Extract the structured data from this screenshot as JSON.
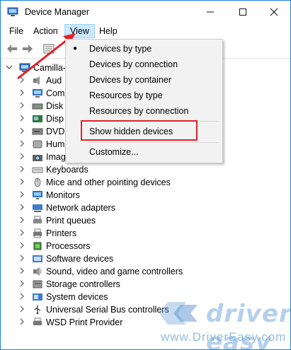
{
  "window": {
    "title": "Device Manager",
    "controls": {
      "minimize": "—",
      "maximize": "☐",
      "close": "✕"
    }
  },
  "menubar": {
    "file": "File",
    "action": "Action",
    "view": "View",
    "help": "Help"
  },
  "tree": {
    "root": "Camilla-",
    "items": [
      {
        "label": "Aud",
        "icon": "audio-icon"
      },
      {
        "label": "Com",
        "icon": "computer-icon"
      },
      {
        "label": "Disk",
        "icon": "disk-drive-icon"
      },
      {
        "label": "Disp",
        "icon": "display-adapter-icon"
      },
      {
        "label": "DVD",
        "icon": "dvd-drive-icon"
      },
      {
        "label": "Hum",
        "icon": "hid-icon"
      },
      {
        "label": "Imag",
        "icon": "imaging-icon"
      },
      {
        "label": "Keyboards",
        "icon": "keyboard-icon"
      },
      {
        "label": "Mice and other pointing devices",
        "icon": "mouse-icon"
      },
      {
        "label": "Monitors",
        "icon": "monitor-icon"
      },
      {
        "label": "Network adapters",
        "icon": "network-icon"
      },
      {
        "label": "Print queues",
        "icon": "print-queue-icon"
      },
      {
        "label": "Printers",
        "icon": "printer-icon"
      },
      {
        "label": "Processors",
        "icon": "processor-icon"
      },
      {
        "label": "Software devices",
        "icon": "software-device-icon"
      },
      {
        "label": "Sound, video and game controllers",
        "icon": "sound-icon"
      },
      {
        "label": "Storage controllers",
        "icon": "storage-icon"
      },
      {
        "label": "System devices",
        "icon": "system-device-icon"
      },
      {
        "label": "Universal Serial Bus controllers",
        "icon": "usb-icon"
      },
      {
        "label": "WSD Print Provider",
        "icon": "wsd-icon"
      }
    ]
  },
  "view_menu": {
    "items": [
      {
        "label": "Devices by type",
        "checked": true
      },
      {
        "label": "Devices by connection",
        "checked": false
      },
      {
        "label": "Devices by container",
        "checked": false
      },
      {
        "label": "Resources by type",
        "checked": false
      },
      {
        "label": "Resources by connection",
        "checked": false
      },
      {
        "label": "Show hidden devices",
        "checked": false,
        "highlighted": true
      },
      {
        "label": "Customize...",
        "checked": false
      }
    ]
  },
  "watermark": {
    "logo": "driver easy",
    "url": "www.DriverEasy.com"
  },
  "colors": {
    "accent": "#1a82d6",
    "highlight": "#e32127",
    "menu_selected": "#cce8ff"
  }
}
